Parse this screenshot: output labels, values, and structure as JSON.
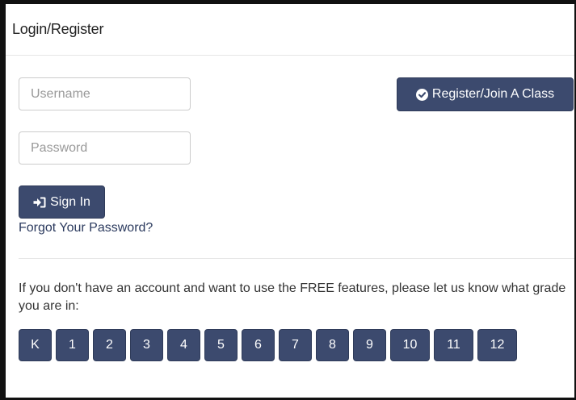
{
  "header": {
    "title": "Login/Register"
  },
  "login": {
    "username_placeholder": "Username",
    "password_placeholder": "Password",
    "signin_label": "Sign In",
    "forgot_label": "Forgot Your Password?"
  },
  "register": {
    "label": "Register/Join A Class"
  },
  "info": {
    "text": "If you don't have an account and want to use the FREE features, please let us know what grade you are in:"
  },
  "grades": [
    "K",
    "1",
    "2",
    "3",
    "4",
    "5",
    "6",
    "7",
    "8",
    "9",
    "10",
    "11",
    "12"
  ],
  "colors": {
    "button_bg": "#3c4a6e",
    "link": "#2b3a5e"
  },
  "icons": {
    "register": "check-circle-icon",
    "signin": "sign-in-icon"
  }
}
